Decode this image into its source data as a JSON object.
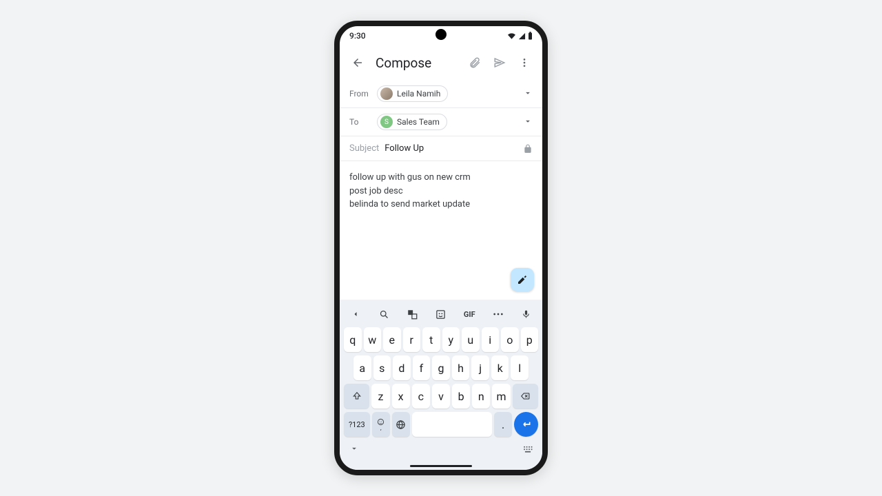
{
  "status": {
    "time": "9:30"
  },
  "appbar": {
    "title": "Compose"
  },
  "fields": {
    "from_label": "From",
    "from_name": "Leila Namih",
    "to_label": "To",
    "to_name": "Sales Team",
    "to_initial": "S",
    "subject_label": "Subject",
    "subject_value": "Follow Up"
  },
  "body": {
    "line1": "follow up with gus on new crm",
    "line2": "post job desc",
    "line3": "belinda to send market update"
  },
  "keyboard": {
    "gif": "GIF",
    "sym": "?123",
    "period": ".",
    "comma": ",",
    "row1": [
      "q",
      "w",
      "e",
      "r",
      "t",
      "y",
      "u",
      "i",
      "o",
      "p"
    ],
    "row2": [
      "a",
      "s",
      "d",
      "f",
      "g",
      "h",
      "j",
      "k",
      "l"
    ],
    "row3": [
      "z",
      "x",
      "c",
      "v",
      "b",
      "n",
      "m"
    ]
  }
}
